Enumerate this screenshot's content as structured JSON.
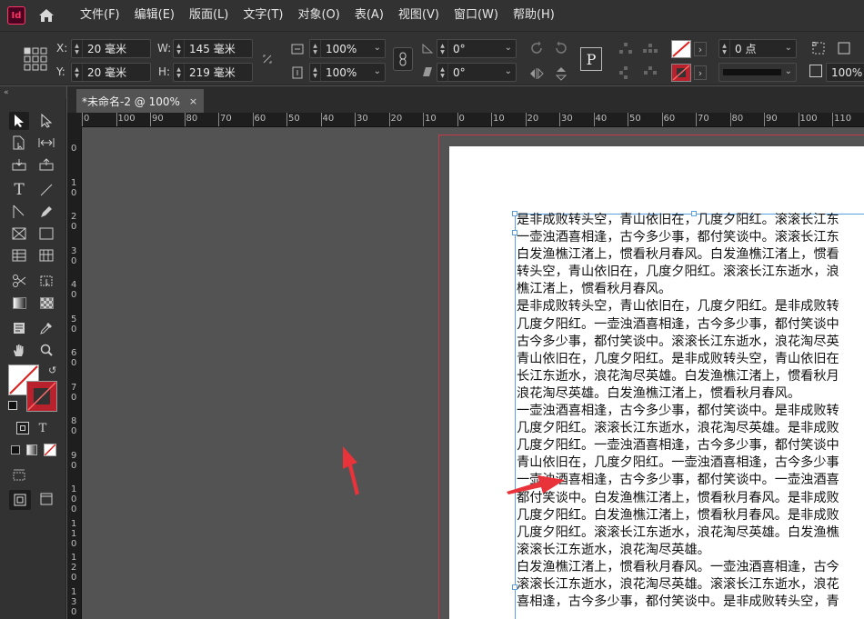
{
  "app": {
    "logo_text": "Id"
  },
  "menu": [
    "文件(F)",
    "编辑(E)",
    "版面(L)",
    "文字(T)",
    "对象(O)",
    "表(A)",
    "视图(V)",
    "窗口(W)",
    "帮助(H)"
  ],
  "control": {
    "x_label": "X:",
    "x_value": "20 毫米",
    "y_label": "Y:",
    "y_value": "20 毫米",
    "w_label": "W:",
    "w_value": "145 毫米",
    "h_label": "H:",
    "h_value": "219 毫米",
    "scale_x": "100%",
    "scale_y": "100%",
    "rotate": "0°",
    "shear": "0°",
    "stroke_weight": "0 点",
    "opacity": "100%",
    "paragraph_glyph": "P"
  },
  "tab": {
    "title": "*未命名-2 @ 100%",
    "close": "×"
  },
  "ruler_h": [
    "0",
    "100",
    "90",
    "80",
    "70",
    "60",
    "50",
    "40",
    "30",
    "20",
    "10",
    "0",
    "10",
    "20",
    "30",
    "40",
    "50",
    "60",
    "70",
    "80",
    "90",
    "100",
    "110"
  ],
  "ruler_v": [
    "0",
    "1\n0",
    "2\n0",
    "3\n0",
    "4\n0",
    "5\n0",
    "6\n0",
    "7\n0",
    "8\n0",
    "9\n0",
    "1\n0\n0",
    "1\n1\n0",
    "1\n2\n0",
    "1\n3\n0"
  ],
  "story": [
    "是非成败转头空，青山依旧在，几度夕阳红。滚滚长江东",
    "一壶浊酒喜相逢，古今多少事，都付笑谈中。滚滚长江东",
    "白发渔樵江渚上，惯看秋月春风。白发渔樵江渚上，惯看",
    "转头空，青山依旧在，几度夕阳红。滚滚长江东逝水，浪",
    "樵江渚上，惯看秋月春风。",
    "是非成败转头空，青山依旧在，几度夕阳红。是非成败转",
    "几度夕阳红。一壶浊酒喜相逢，古今多少事，都付笑谈中",
    "古今多少事，都付笑谈中。滚滚长江东逝水，浪花淘尽英",
    "青山依旧在，几度夕阳红。是非成败转头空，青山依旧在",
    "长江东逝水，浪花淘尽英雄。白发渔樵江渚上，惯看秋月",
    "浪花淘尽英雄。白发渔樵江渚上，惯看秋月春风。",
    "一壶浊酒喜相逢，古今多少事，都付笑谈中。是非成败转",
    "几度夕阳红。滚滚长江东逝水，浪花淘尽英雄。是非成败",
    "几度夕阳红。一壶浊酒喜相逢，古今多少事，都付笑谈中",
    "青山依旧在，几度夕阳红。一壶浊酒喜相逢，古今多少事",
    "一壶浊酒喜相逢，古今多少事，都付笑谈中。一壶浊酒喜",
    "都付笑谈中。白发渔樵江渚上，惯看秋月春风。是非成败",
    "几度夕阳红。白发渔樵江渚上，惯看秋月春风。是非成败",
    "几度夕阳红。滚滚长江东逝水，浪花淘尽英雄。白发渔樵",
    "滚滚长江东逝水，浪花淘尽英雄。",
    "白发渔樵江渚上，惯看秋月春风。一壶浊酒喜相逢，古今",
    "滚滚长江东逝水，浪花淘尽英雄。滚滚长江东逝水，浪花",
    "喜相逢，古今多少事，都付笑谈中。是非成败转头空，青"
  ],
  "colors": {
    "accent_arrow": "#e8333a",
    "frame": "#5ba0e0",
    "bleed": "#c23a4a"
  }
}
